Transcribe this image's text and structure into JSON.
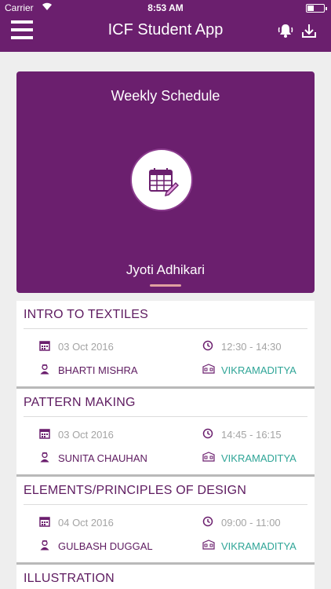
{
  "status_bar": {
    "carrier": "Carrier",
    "time": "8:53 AM"
  },
  "app": {
    "title": "ICF Student App"
  },
  "icons": {
    "menu": "menu-icon",
    "bell": "bell-icon",
    "download": "download-icon",
    "calendar": "calendar-icon",
    "clock": "clock-icon",
    "teacher": "teacher-icon",
    "room": "room-icon",
    "schedule": "schedule-edit-icon"
  },
  "colors": {
    "brand": "#6b1f6e",
    "teal": "#2fa597",
    "muted": "#a4a4a4"
  },
  "header_card": {
    "title": "Weekly Schedule",
    "student_name": "Jyoti Adhikari"
  },
  "courses": [
    {
      "title": "INTRO TO TEXTILES",
      "date": "03 Oct 2016",
      "time": "12:30 - 14:30",
      "teacher": "BHARTI MISHRA",
      "room": "VIKRAMADITYA"
    },
    {
      "title": "PATTERN MAKING",
      "date": "03 Oct 2016",
      "time": "14:45 - 16:15",
      "teacher": "SUNITA CHAUHAN",
      "room": "VIKRAMADITYA"
    },
    {
      "title": "ELEMENTS/PRINCIPLES OF DESIGN",
      "date": "04 Oct 2016",
      "time": "09:00 - 11:00",
      "teacher": "GULBASH DUGGAL",
      "room": "VIKRAMADITYA"
    },
    {
      "title": "ILLUSTRATION"
    }
  ]
}
